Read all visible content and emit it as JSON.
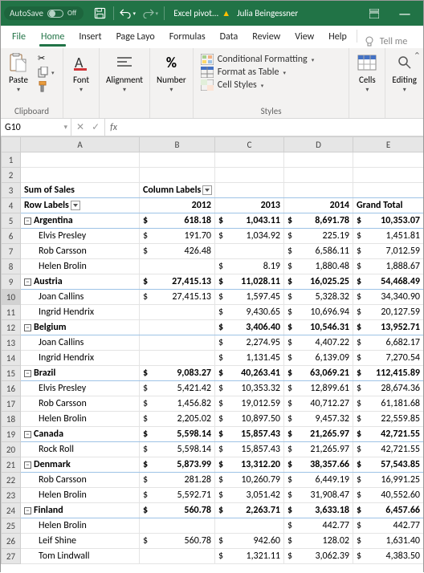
{
  "titlebar": {
    "autosave_label": "AutoSave",
    "autosave_state": "Off",
    "filename": "Excel pivot...",
    "username": "Julia Beingessner"
  },
  "tabs": {
    "file": "File",
    "home": "Home",
    "insert": "Insert",
    "page_layout": "Page Layo",
    "formulas": "Formulas",
    "data": "Data",
    "review": "Review",
    "view": "View",
    "help": "Help",
    "tell_me": "Tell me"
  },
  "ribbon": {
    "clipboard": {
      "label": "Clipboard",
      "paste": "Paste"
    },
    "font": {
      "label": "Font",
      "btn": "Font"
    },
    "alignment": {
      "label": "Alignment",
      "btn": "Alignment"
    },
    "number": {
      "label": "Number",
      "btn": "Number"
    },
    "styles": {
      "label": "Styles",
      "cond": "Conditional Formatting",
      "table": "Format as Table",
      "cell": "Cell Styles"
    },
    "cells": {
      "label": "Cells",
      "btn": "Cells"
    },
    "editing": {
      "label": "Editing",
      "btn": "Editing"
    }
  },
  "namebox": "G10",
  "colheads": [
    "A",
    "B",
    "C",
    "D",
    "E"
  ],
  "rows": [
    {
      "n": 1,
      "cells": [
        "",
        "",
        "",
        "",
        ""
      ]
    },
    {
      "n": 2,
      "cells": [
        "",
        "",
        "",
        "",
        ""
      ]
    },
    {
      "n": 3,
      "type": "section",
      "a": "Sum of Sales",
      "b": "Column Labels",
      "bfilter": true
    },
    {
      "n": 4,
      "type": "totalhdr",
      "a": "Row Labels",
      "afilter": true,
      "b": "2012",
      "c": "2013",
      "d": "2014",
      "e": "Grand Total"
    },
    {
      "n": 5,
      "type": "country",
      "a": "Argentina",
      "b": "618.18",
      "c": "1,043.11",
      "d": "8,691.78",
      "e": "10,353.07"
    },
    {
      "n": 6,
      "a": "Elvis Presley",
      "b": "191.70",
      "c": "1,034.92",
      "d": "225.19",
      "e": "1,451.81"
    },
    {
      "n": 7,
      "a": "Rob Carsson",
      "b": "426.48",
      "c": "",
      "d": "6,586.11",
      "e": "7,012.59"
    },
    {
      "n": 8,
      "a": "Helen Brolin",
      "b": "",
      "c": "8.19",
      "d": "1,880.48",
      "e": "1,888.67"
    },
    {
      "n": 9,
      "type": "country",
      "a": "Austria",
      "b": "27,415.13",
      "c": "11,028.11",
      "d": "16,025.25",
      "e": "54,468.49"
    },
    {
      "n": 10,
      "a": "Joan Callins",
      "b": "27,415.13",
      "c": "1,597.45",
      "d": "5,328.32",
      "e": "34,340.90",
      "sel": true
    },
    {
      "n": 11,
      "a": "Ingrid Hendrix",
      "b": "",
      "c": "9,430.65",
      "d": "10,696.94",
      "e": "20,127.59"
    },
    {
      "n": 12,
      "type": "country",
      "a": "Belgium",
      "b": "",
      "c": "3,406.40",
      "d": "10,546.31",
      "e": "13,952.71"
    },
    {
      "n": 13,
      "a": "Joan Callins",
      "b": "",
      "c": "2,274.95",
      "d": "4,407.22",
      "e": "6,682.17"
    },
    {
      "n": 14,
      "a": "Ingrid Hendrix",
      "b": "",
      "c": "1,131.45",
      "d": "6,139.09",
      "e": "7,270.54"
    },
    {
      "n": 15,
      "type": "country",
      "a": "Brazil",
      "b": "9,083.27",
      "c": "40,263.41",
      "d": "63,069.21",
      "e": "112,415.89"
    },
    {
      "n": 16,
      "a": "Elvis Presley",
      "b": "5,421.42",
      "c": "10,353.32",
      "d": "12,899.61",
      "e": "28,674.36"
    },
    {
      "n": 17,
      "a": "Rob Carsson",
      "b": "1,456.82",
      "c": "19,012.59",
      "d": "40,712.27",
      "e": "61,181.68"
    },
    {
      "n": 18,
      "a": "Helen Brolin",
      "b": "2,205.02",
      "c": "10,897.50",
      "d": "9,457.32",
      "e": "22,559.85"
    },
    {
      "n": 19,
      "type": "country",
      "a": "Canada",
      "b": "5,598.14",
      "c": "15,857.43",
      "d": "21,265.97",
      "e": "42,721.55"
    },
    {
      "n": 20,
      "a": "Rock Roll",
      "b": "5,598.14",
      "c": "15,857.43",
      "d": "21,265.97",
      "e": "42,721.55"
    },
    {
      "n": 21,
      "type": "country",
      "a": "Denmark",
      "b": "5,873.99",
      "c": "13,312.20",
      "d": "38,357.66",
      "e": "57,543.85"
    },
    {
      "n": 22,
      "a": "Rob Carsson",
      "b": "281.28",
      "c": "10,260.79",
      "d": "6,449.19",
      "e": "16,991.25"
    },
    {
      "n": 23,
      "a": "Helen Brolin",
      "b": "5,592.71",
      "c": "3,051.42",
      "d": "31,908.47",
      "e": "40,552.60"
    },
    {
      "n": 24,
      "type": "country",
      "a": "Finland",
      "b": "560.78",
      "c": "2,263.71",
      "d": "3,633.18",
      "e": "6,457.66"
    },
    {
      "n": 25,
      "a": "Helen Brolin",
      "b": "",
      "c": "",
      "d": "442.77",
      "e": "442.77"
    },
    {
      "n": 26,
      "a": "Leif Shine",
      "b": "560.78",
      "c": "942.60",
      "d": "128.02",
      "e": "1,631.40"
    },
    {
      "n": 27,
      "a": "Tom Lindwall",
      "b": "",
      "c": "1,321.11",
      "d": "3,062.39",
      "e": "4,383.50"
    }
  ]
}
